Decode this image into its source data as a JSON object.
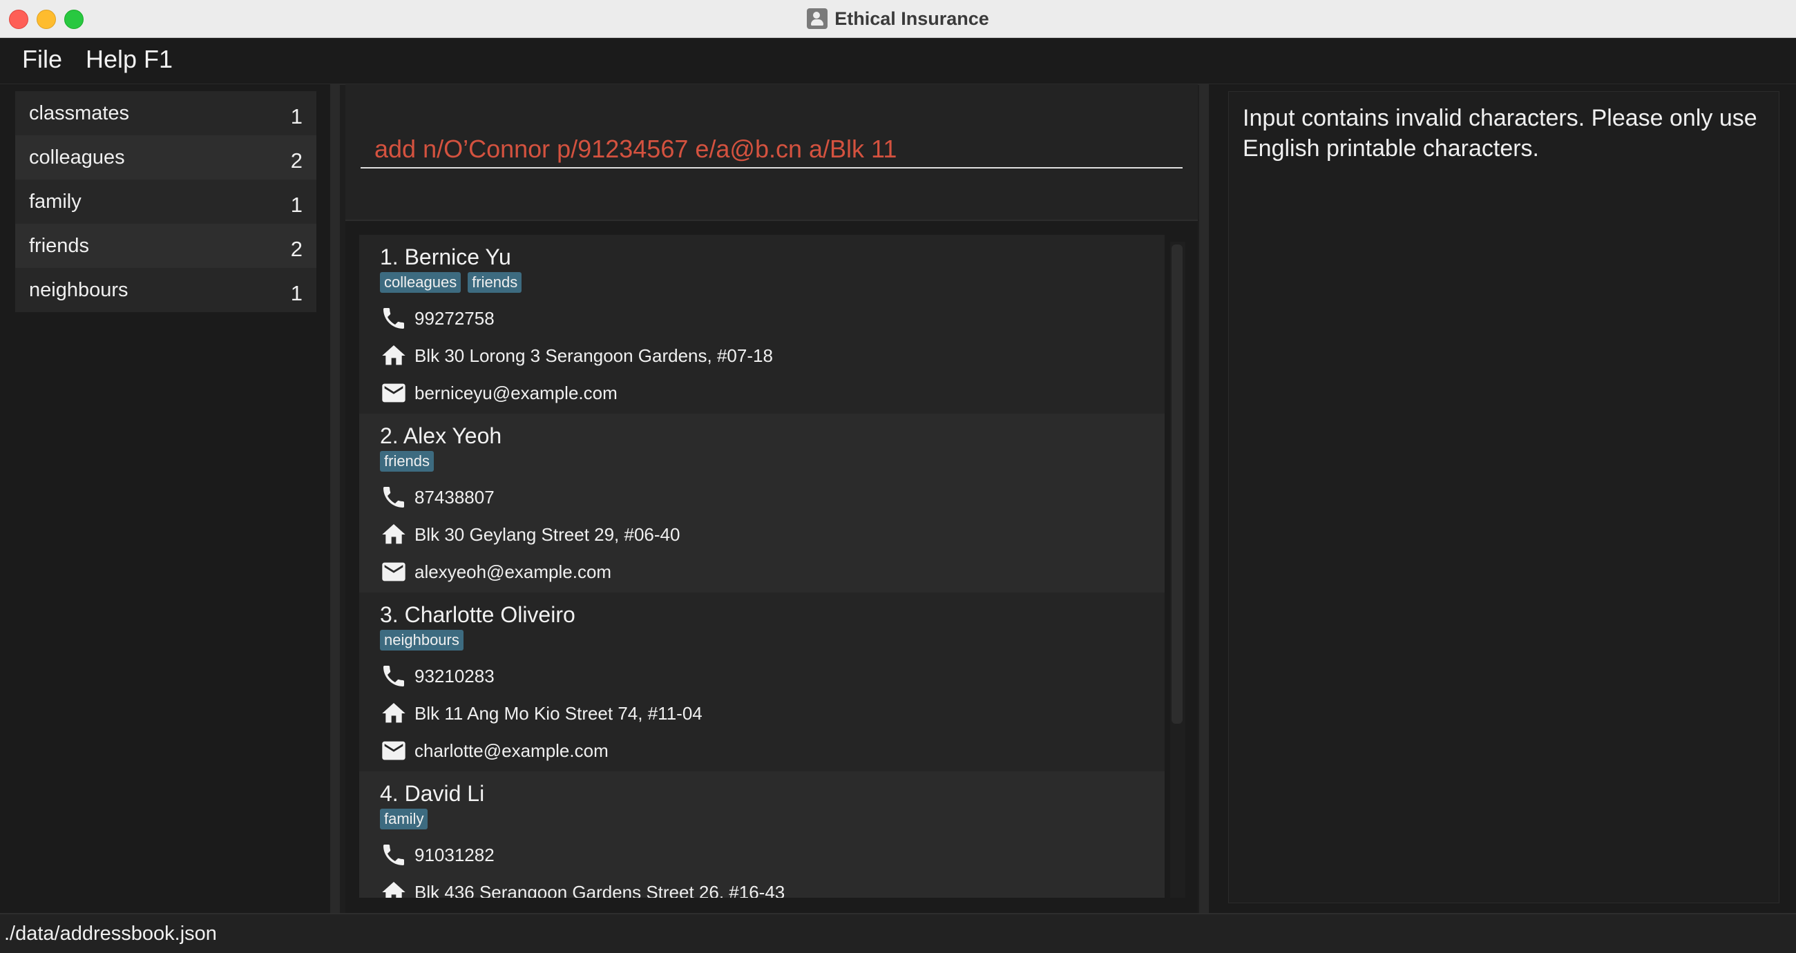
{
  "window": {
    "title": "Ethical Insurance"
  },
  "menu": {
    "file": "File",
    "help": "Help F1"
  },
  "tag_panel": {
    "items": [
      {
        "label": "classmates",
        "count": "1"
      },
      {
        "label": "colleagues",
        "count": "2"
      },
      {
        "label": "family",
        "count": "1"
      },
      {
        "label": "friends",
        "count": "2"
      },
      {
        "label": "neighbours",
        "count": "1"
      }
    ]
  },
  "command": {
    "value": "add n/O’Connor p/91234567 e/a@b.cn a/Blk 11",
    "text_color": "#d4523f"
  },
  "result": {
    "message": "Input contains invalid characters. Please only use English printable characters."
  },
  "persons": [
    {
      "name": "1. Bernice Yu",
      "tags": [
        "colleagues",
        "friends"
      ],
      "phone": "99272758",
      "address": "Blk 30 Lorong 3 Serangoon Gardens, #07-18",
      "email": "berniceyu@example.com"
    },
    {
      "name": "2. Alex Yeoh",
      "tags": [
        "friends"
      ],
      "phone": "87438807",
      "address": "Blk 30 Geylang Street 29, #06-40",
      "email": "alexyeoh@example.com"
    },
    {
      "name": "3. Charlotte Oliveiro",
      "tags": [
        "neighbours"
      ],
      "phone": "93210283",
      "address": "Blk 11 Ang Mo Kio Street 74, #11-04",
      "email": "charlotte@example.com"
    },
    {
      "name": "4. David Li",
      "tags": [
        "family"
      ],
      "phone": "91031282",
      "address": "Blk 436 Serangoon Gardens Street 26, #16-43",
      "email": ""
    }
  ],
  "status": {
    "file_path": "./data/addressbook.json"
  },
  "icons": {
    "phone": "phone-icon",
    "address": "home-icon",
    "email": "mail-icon"
  },
  "colors": {
    "tag_bg": "#3d6b80",
    "error_text": "#d4523f"
  }
}
